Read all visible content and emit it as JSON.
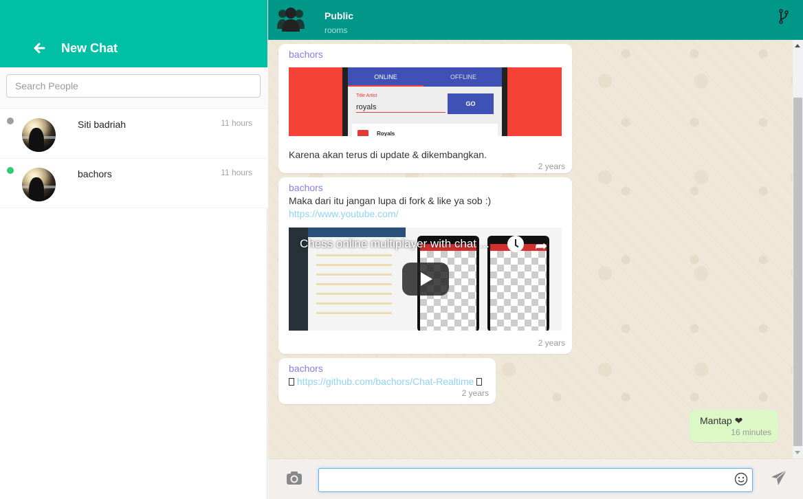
{
  "sidebar": {
    "title": "New Chat",
    "back_icon": "arrow-left-icon",
    "search": {
      "placeholder": "Search People",
      "value": ""
    },
    "contacts": [
      {
        "name": "Siti badriah",
        "time": "11 hours",
        "status": "offline",
        "status_color": "#9e9e9e"
      },
      {
        "name": "bachors",
        "time": "11 hours",
        "status": "online",
        "status_color": "#2ecc71"
      }
    ]
  },
  "header": {
    "title": "Public",
    "subtitle": "rooms",
    "group_icon": "group-icon",
    "action_icon": "code-fork-icon"
  },
  "messages": [
    {
      "sender": "bachors",
      "image": {
        "tabs": [
          "ONLINE",
          "OFFLINE"
        ],
        "field_label": "Title Artist",
        "field_value": "royals",
        "button": "GO",
        "result": "Royals"
      },
      "text": "Karena akan terus di update & dikembangkan.",
      "time": "2 years"
    },
    {
      "sender": "bachors",
      "text": "Maka dari itu jangan lupa di fork & like ya sob :)",
      "link": "https://www.youtube.com/",
      "video": {
        "title": "Chess online multiplayer with chat ..."
      },
      "time": "2 years"
    },
    {
      "sender": "bachors",
      "link": "https://github.com/bachors/Chat-Realtime",
      "time": "2 years"
    },
    {
      "own": true,
      "text": "Mantap ❤",
      "time": "16 minutes"
    }
  ],
  "composer": {
    "placeholder": "",
    "value": "",
    "camera_icon": "camera-icon",
    "emoji_icon": "smiley-icon",
    "send_icon": "paper-plane-icon"
  },
  "colors": {
    "sidebar_header": "#00bfa5",
    "chat_header": "#009688",
    "sender_name": "#8c7ae6",
    "link": "#8fd3f4",
    "own_bubble": "#dcf8c6"
  }
}
